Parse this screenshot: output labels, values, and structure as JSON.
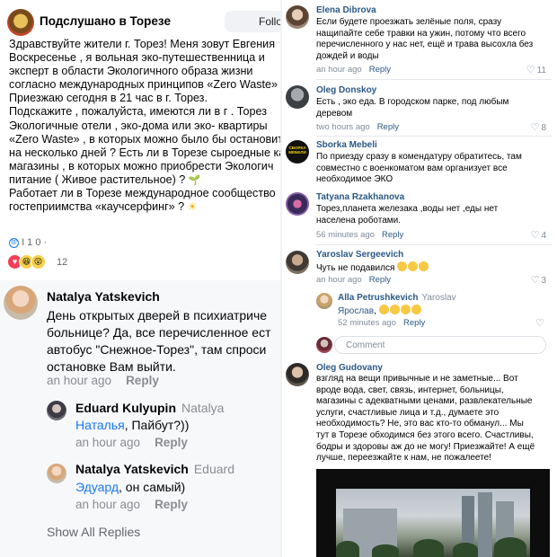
{
  "post": {
    "group_name": "Подслушано в Торезе",
    "follow_label": "Follow",
    "lines": [
      "Здравствуйте жители г. Торез! Меня зовут Евгения",
      "Воскресенье , я вольная эко-путешественница и",
      "эксперт в области Экологичного образа жизни",
      "согласно международных принципов «Zero Waste»",
      "Приезжаю сегодня в 21 час в г. Торез.",
      "Подскажите , пожалуйста, имеются ли в г . Торез",
      "Экологичные отели , эко-дома или эко- квартиры",
      "«Zero Waste» , в которых можно было бы остановит",
      "на несколько дней ? Есть ли в Торезе сыроедные ка",
      "магазины , в которых можно приобрести Экологич",
      "питание ( Живое растительное) ?",
      "Работает ли в Торезе международное сообщество",
      "гостеприимства «каучсерфинг» ?"
    ],
    "tag_text": "I 1 0 ·",
    "reaction_count": "12"
  },
  "fb_comments": [
    {
      "name": "Natalya Yatskevich",
      "lines": [
        "День открытых дверей в психиатриче",
        "больнице? Да, все перечисленное ест",
        "автобус \"Снежное-Торез\", там спроси",
        "остановке Вам выйти."
      ],
      "time": "an hour ago",
      "reply": "Reply"
    },
    {
      "name": "Eduard Kulyupin",
      "reply_to": "Natalya",
      "mention": "Наталья",
      "text": ", Пайбут?))",
      "time": "an hour ago",
      "reply": "Reply"
    },
    {
      "name": "Natalya Yatskevich",
      "reply_to": "Eduard",
      "mention": "Эдуард",
      "text": ", он самый)",
      "time": "an hour ago",
      "reply": "Reply"
    }
  ],
  "show_all_replies": "Show All Replies",
  "vk_comments": [
    {
      "name": "Elena Dibrova",
      "lines": [
        "Если будете проезжать зелёные поля, сразу",
        "нащипайте себе травки на ужин, потому что всего",
        "перечисленного у нас нет, ещё и трава высохла без",
        "дождей и воды"
      ],
      "time": "an hour ago",
      "reply": "Reply",
      "likes": "11"
    },
    {
      "name": "Oleg Donskoy",
      "lines": [
        "Есть , эко еда. В городском парке, под любым",
        "деревом"
      ],
      "time": "two hours ago",
      "reply": "Reply",
      "likes": "8"
    },
    {
      "name": "Sborka Mebeli",
      "avatar_text": "СБОРКА МЕБЕЛИ",
      "lines": [
        "По приезду сразу в комендатуру обратитесь, там",
        "совместно с военкоматом вам организует все",
        "необходимое ЭКО"
      ],
      "time": "",
      "reply": ""
    },
    {
      "name": "Tatyana Rzakhanova",
      "lines": [
        "Торез,планета железака ,воды нет ,еды нет",
        "населена роботами."
      ],
      "time": "56 minutes ago",
      "reply": "Reply",
      "likes": "4"
    },
    {
      "name": "Yaroslav Sergeevich",
      "text": "Чуть не подавился",
      "time": "an hour ago",
      "reply": "Reply",
      "likes": "3"
    },
    {
      "name": "Alla Petrushkevich",
      "reply_to": "Yaroslav",
      "mention": "Ярослав",
      "text": ",",
      "time": "52 minutes ago",
      "reply": "Reply"
    }
  ],
  "comment_placeholder": "Comment",
  "last_comment": {
    "name": "Oleg Gudovany",
    "lines": [
      "взгляд на вещи привычные и не заметные... Вот",
      "вроде вода, свет, связь, интернет, больницы,",
      "магазины с адекватными ценами, развлекательные",
      "услуги, счастливые лица и т.д., думаете это",
      "необходимость? Не, это вас кто-то обманул... Мы",
      "тут в Торезе обходимся без этого всего. Счастливы,",
      "бодры и здоровы аж до не могу! Приезжайте! А ещё",
      "лучше, переезжайте к нам, не пожалеете!"
    ]
  },
  "colors": {
    "facebook_link": "#1877f2",
    "vk_link": "#2a5885",
    "muted": "#818c99",
    "heart_reaction": "#f33e58"
  },
  "icons": [
    "group-avatar-icon",
    "heart-reaction-icon",
    "laugh-reaction-icon",
    "wow-reaction-icon",
    "like-heart-icon",
    "sprout-emoji-icon",
    "sun-emoji-icon"
  ]
}
